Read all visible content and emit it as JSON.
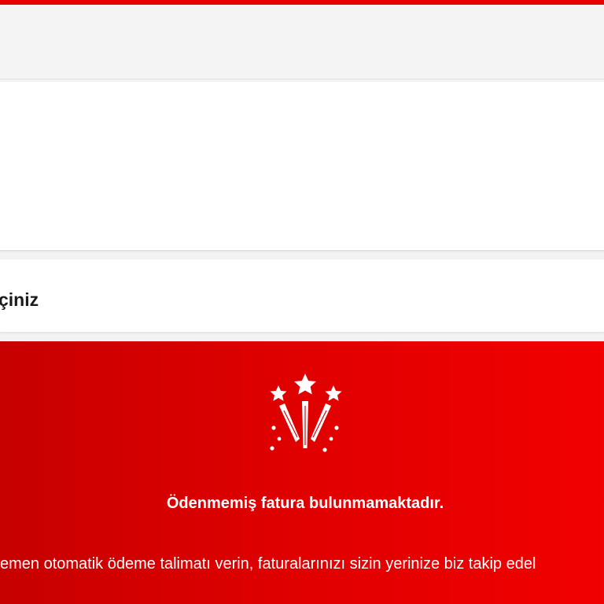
{
  "section": {
    "title": "çiniz"
  },
  "promo": {
    "icon": "fireworks-icon",
    "title": "Ödenmemiş fatura bulunmamaktadır.",
    "text": "emen otomatik ödeme talimatı verin, faturalarınızı sizin yerinize biz takip edel"
  },
  "colors": {
    "accent": "#e60000",
    "panel_left": "#c70000",
    "panel_right": "#f20000",
    "page_bg": "#f2f2f2",
    "card_bg": "#ffffff",
    "text_dark": "#1a1a1a",
    "text_light": "#ffffff"
  }
}
